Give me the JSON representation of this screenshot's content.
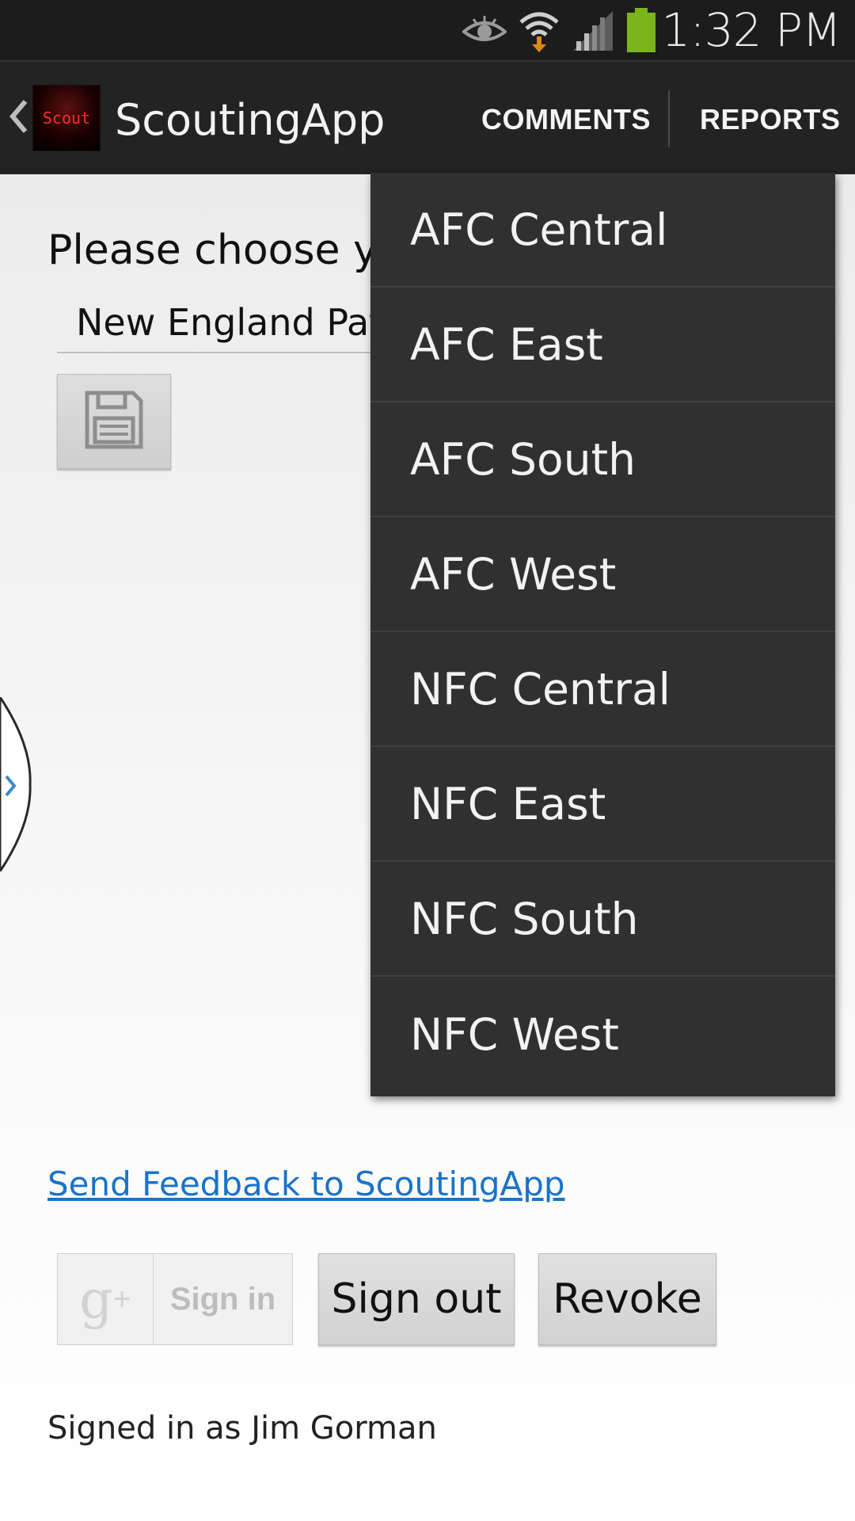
{
  "status_bar": {
    "time": "1:32 PM",
    "icons": [
      "eye-icon",
      "wifi-download-icon",
      "signal-icon",
      "battery-icon"
    ],
    "battery_color": "#7cb41e"
  },
  "action_bar": {
    "title": "ScoutingApp",
    "logo_text": "Scout",
    "actions": [
      "COMMENTS",
      "REPORTS"
    ]
  },
  "main": {
    "prompt": "Please choose yo",
    "spinner_value": "New England Patr",
    "save_icon": "save-icon"
  },
  "dropdown": {
    "items": [
      "AFC Central",
      "AFC East",
      "AFC South",
      "AFC West",
      "NFC Central",
      "NFC East",
      "NFC South",
      "NFC West"
    ]
  },
  "feedback_link": "Send Feedback to ScoutingApp",
  "buttons": {
    "sign_in": "Sign in",
    "sign_out": "Sign out",
    "revoke": "Revoke"
  },
  "signed_in_text": "Signed in as Jim Gorman",
  "colors": {
    "link": "#1a73c8",
    "dropdown_bg": "#303030",
    "action_bar_bg": "#232323"
  }
}
